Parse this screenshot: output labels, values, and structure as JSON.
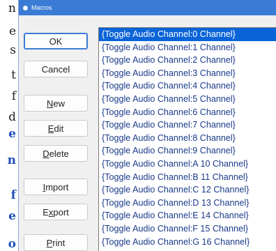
{
  "background_doc": {
    "fragments": [
      {
        "text": "n",
        "link": false
      },
      {
        "text": "e",
        "link": false
      },
      {
        "text": "s",
        "link": false
      },
      {
        "text": "",
        "link": false
      },
      {
        "text": "t",
        "link": false
      },
      {
        "text": "f",
        "link": false
      },
      {
        "text": "d",
        "link": false
      },
      {
        "text": "e",
        "link": true
      },
      {
        "text": "n",
        "link": true
      },
      {
        "text": "f",
        "link": true
      },
      {
        "text": "e",
        "link": true
      },
      {
        "text": "o",
        "link": true
      }
    ]
  },
  "window": {
    "title": "Macros"
  },
  "buttons": {
    "ok": "OK",
    "cancel": "Cancel",
    "new_pre": "",
    "new_ul": "N",
    "new_post": "ew",
    "edit_pre": "",
    "edit_ul": "E",
    "edit_post": "dit",
    "delete_pre": "",
    "delete_ul": "D",
    "delete_post": "elete",
    "import_pre": "",
    "import_ul": "I",
    "import_post": "mport",
    "export_pre": "E",
    "export_ul": "x",
    "export_post": "port",
    "print_pre": "",
    "print_ul": "P",
    "print_post": "rint"
  },
  "macro_list": {
    "selected_index": 0,
    "items": [
      "{Toggle Audio Channel:0 Channel}",
      "{Toggle Audio Channel:1 Channel}",
      "{Toggle Audio Channel:2 Channel}",
      "{Toggle Audio Channel:3 Channel}",
      "{Toggle Audio Channel:4 Channel}",
      "{Toggle Audio Channel:5 Channel}",
      "{Toggle Audio Channel:6 Channel}",
      "{Toggle Audio Channel:7 Channel}",
      "{Toggle Audio Channel:8 Channel}",
      "{Toggle Audio Channel:9 Channel}",
      "{Toggle Audio Channel:A 10 Channel}",
      "{Toggle Audio Channel:B 11 Channel}",
      "{Toggle Audio Channel:C 12 Channel}",
      "{Toggle Audio Channel:D 13 Channel}",
      "{Toggle Audio Channel:E 14 Channel}",
      "{Toggle Audio Channel:F 15 Channel}",
      "{Toggle Audio Channel:G 16 Channel}"
    ]
  },
  "colors": {
    "titlebar": "#3a7bd5",
    "selection": "#0a64d8",
    "list_text": "#1a3a8a",
    "link_text": "#1f4fb8"
  }
}
